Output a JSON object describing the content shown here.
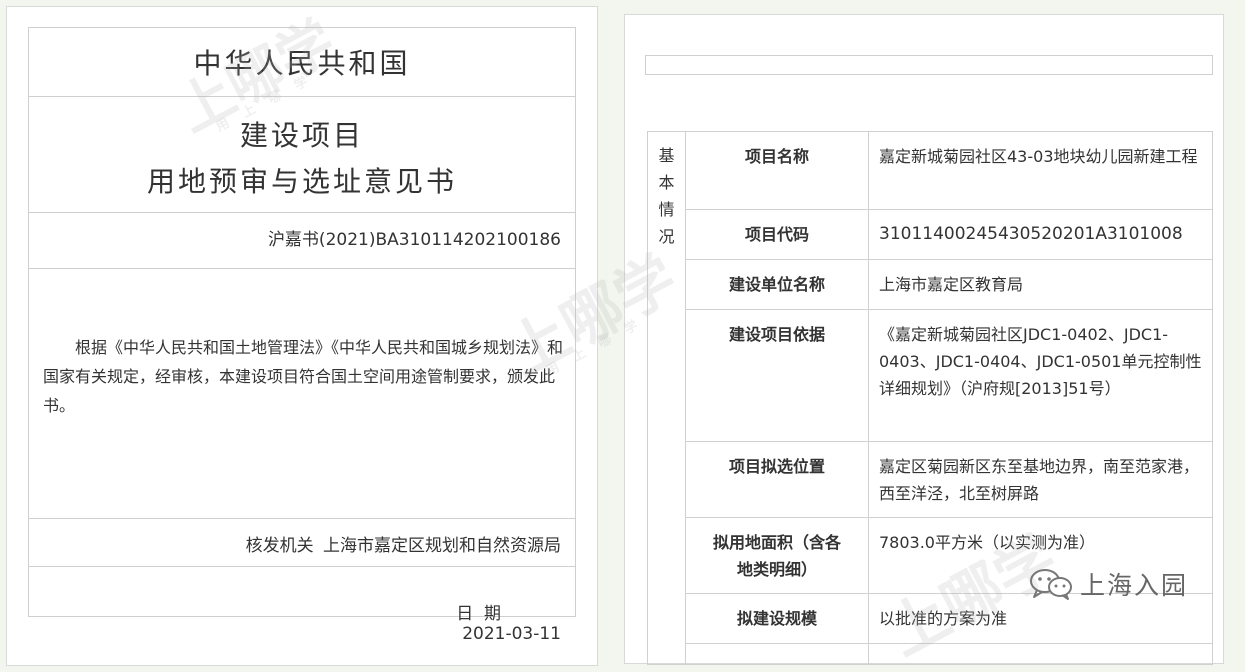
{
  "certificate": {
    "country": "中华人民共和国",
    "title_line1": "建设项目",
    "title_line2": "用地预审与选址意见书",
    "number": "沪嘉书(2021)BA310114202100186",
    "body": "根据《中华人民共和国土地管理法》《中华人民共和国城乡规划法》和国家有关规定，经审核，本建设项目符合国土空间用途管制要求，颁发此书。",
    "issuer_label": "核发机关",
    "issuer": "上海市嘉定区规划和自然资源局",
    "date_label": "日  期",
    "date": "2021-03-11"
  },
  "basic_info": {
    "section_label": "基本情况",
    "rows": [
      {
        "field": "项目名称",
        "value": "嘉定新城菊园社区43-03地块幼儿园新建工程"
      },
      {
        "field": "项目代码",
        "value": "310114002454305202­01A3101008"
      },
      {
        "field": "建设单位名称",
        "value": "上海市嘉定区教育局"
      },
      {
        "field": "建设项目依据",
        "value": "《嘉定新城菊园社区JDC1-0402、JDC1-0403、JDC1-0404、JDC1-0501单元控制性详细规划》（沪府规[2013]51号）"
      },
      {
        "field": "项目拟选位置",
        "value": "嘉定区菊园新区东至基地边界，南至范家港，西至洋泾，北至树屏路"
      },
      {
        "field": "拟用地面积（含各地类明细）",
        "value": "7803.0平方米（以实测为准）"
      },
      {
        "field": "拟建设规模",
        "value": "以批准的方案为准"
      }
    ]
  },
  "watermark": {
    "text": "上哪学",
    "sub": "用 上 哪 学"
  },
  "brand": {
    "name": "上海入园",
    "icon": "wechat-icon"
  }
}
